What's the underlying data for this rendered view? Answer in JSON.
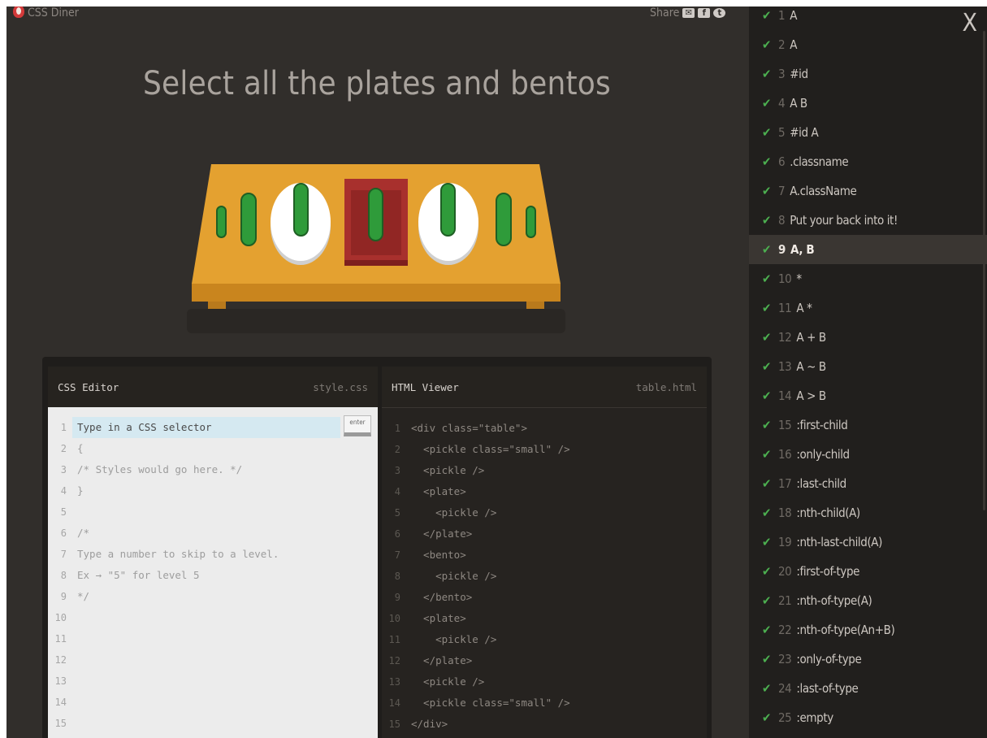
{
  "header": {
    "app_name": "CSS Diner",
    "share_label": "Share",
    "share_icons": [
      "mail-icon",
      "facebook-icon",
      "twitter-icon"
    ]
  },
  "title": "Select all the plates and bentos",
  "css_editor": {
    "title": "CSS Editor",
    "filename": "style.css",
    "input_placeholder": "Type in a CSS selector",
    "enter_label": "enter",
    "line_numbers": [
      "1",
      "2",
      "3",
      "4",
      "5",
      "6",
      "7",
      "8",
      "9",
      "10",
      "11",
      "12",
      "13",
      "14",
      "15"
    ],
    "lines": [
      "",
      "{",
      "/* Styles would go here. */",
      "}",
      "",
      "/*",
      "Type a number to skip to a level.",
      "Ex → \"5\" for level 5",
      "*/",
      "",
      "",
      "",
      "",
      "",
      ""
    ]
  },
  "html_viewer": {
    "title": "HTML Viewer",
    "filename": "table.html",
    "line_numbers": [
      "1",
      "2",
      "3",
      "4",
      "5",
      "6",
      "7",
      "8",
      "9",
      "10",
      "11",
      "12",
      "13",
      "14",
      "15"
    ],
    "lines": [
      "<div class=\"table\">",
      "  <pickle class=\"small\" />",
      "  <pickle />",
      "  <plate>",
      "    <pickle />",
      "  </plate>",
      "  <bento>",
      "    <pickle />",
      "  </bento>",
      "  <plate>",
      "    <pickle />",
      "  </plate>",
      "  <pickle />",
      "  <pickle class=\"small\" />",
      "</div>"
    ]
  },
  "levels": {
    "close_label": "X",
    "active_index": 8,
    "items": [
      {
        "num": "1",
        "label": "A"
      },
      {
        "num": "2",
        "label": "A"
      },
      {
        "num": "3",
        "label": "#id"
      },
      {
        "num": "4",
        "label": "A B"
      },
      {
        "num": "5",
        "label": "#id A"
      },
      {
        "num": "6",
        "label": ".classname"
      },
      {
        "num": "7",
        "label": "A.className"
      },
      {
        "num": "8",
        "label": "Put your back into it!"
      },
      {
        "num": "9",
        "label": "A, B"
      },
      {
        "num": "10",
        "label": "*"
      },
      {
        "num": "11",
        "label": "A *"
      },
      {
        "num": "12",
        "label": "A + B"
      },
      {
        "num": "13",
        "label": "A ~ B"
      },
      {
        "num": "14",
        "label": "A > B"
      },
      {
        "num": "15",
        "label": ":first-child"
      },
      {
        "num": "16",
        "label": ":only-child"
      },
      {
        "num": "17",
        "label": ":last-child"
      },
      {
        "num": "18",
        "label": ":nth-child(A)"
      },
      {
        "num": "19",
        "label": ":nth-last-child(A)"
      },
      {
        "num": "20",
        "label": ":first-of-type"
      },
      {
        "num": "21",
        "label": ":nth-of-type(A)"
      },
      {
        "num": "22",
        "label": ":nth-of-type(An+B)"
      },
      {
        "num": "23",
        "label": ":only-of-type"
      },
      {
        "num": "24",
        "label": ":last-of-type"
      },
      {
        "num": "25",
        "label": ":empty"
      }
    ]
  },
  "colors": {
    "check": "#4caf50",
    "table_top": "#e4a130",
    "pickle": "#2f9b3a",
    "bento": "#a8302d",
    "plate": "#ffffff"
  }
}
